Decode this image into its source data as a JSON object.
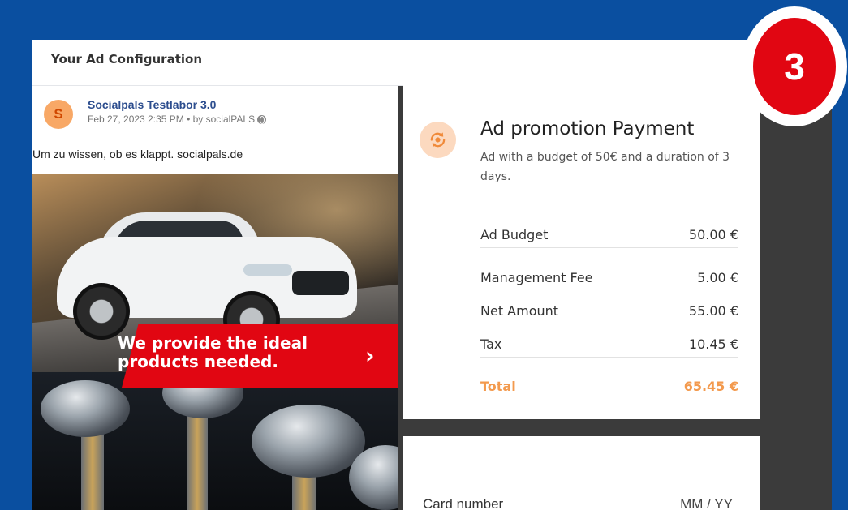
{
  "panel": {
    "title": "Your Ad Configuration"
  },
  "step": {
    "number": "3",
    "color": "#e10612"
  },
  "post": {
    "avatar_letter": "S",
    "page_name": "Socialpals Testlabor 3.0",
    "meta": "Feb 27, 2023 2:35 PM • by socialPALS",
    "meta_icon": "globe-icon",
    "text": "Um zu wissen, ob es klappt. socialpals.de",
    "banner_text": "We provide the ideal products needed.",
    "banner_arrow": "›",
    "banner_color": "#e10612"
  },
  "payment": {
    "icon": "currency-refresh-icon",
    "title": "Ad promotion Payment",
    "description": "Ad with a budget of 50€ and a duration of 3 days.",
    "rows": [
      {
        "label": "Ad Budget",
        "value": "50.00 €"
      },
      {
        "label": "Management Fee",
        "value": "5.00 €"
      },
      {
        "label": "Net Amount",
        "value": "55.00 €"
      },
      {
        "label": "Tax",
        "value": "10.45 €"
      },
      {
        "label": "Total",
        "value": "65.45 €"
      }
    ],
    "accent": "#f39a4e"
  },
  "card_form": {
    "card_number_label": "Card number",
    "expiry_placeholder": "MM / YY"
  }
}
